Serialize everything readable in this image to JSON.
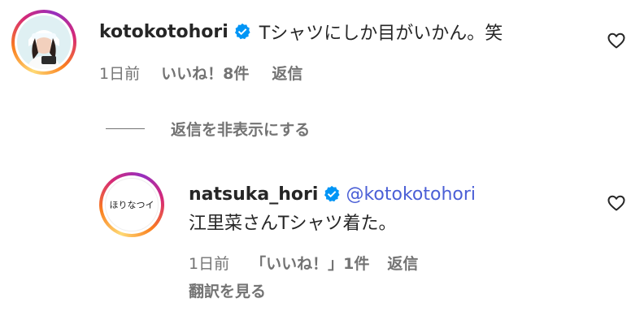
{
  "comment1": {
    "username": "kotokotohori",
    "text": "Tシャツにしか目がいかん。笑",
    "time": "1日前",
    "likes": "いいね！8件",
    "reply": "返信"
  },
  "replies_toggle": {
    "label": "返信を非表示にする"
  },
  "reply1": {
    "username": "natsuka_hori",
    "mention": "@kotokotohori",
    "text": "江里菜さんTシャツ着た。",
    "time": "1日前",
    "likes": "「いいね！」1件",
    "reply": "返信",
    "translate": "翻訳を見る",
    "avatar_logo_text": "ほりなつイ"
  },
  "colors": {
    "verified": "#0095f6",
    "mention": "#4b5fd6",
    "meta": "#737373"
  }
}
